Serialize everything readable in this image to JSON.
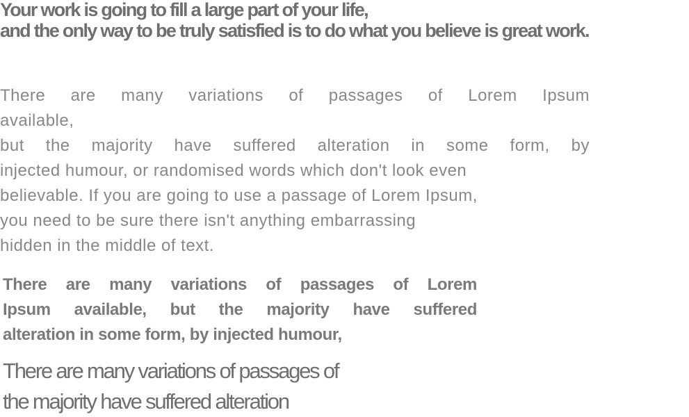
{
  "heading": {
    "line1": "Your work is going to fill a large part of your life,",
    "line2": "and the only way to be truly satisfied is to do what you believe is great work."
  },
  "paragraph_light": {
    "lines": [
      "There are many variations of passages of Lorem Ipsum",
      "available,",
      "but the majority have suffered alteration in some form, by",
      "injected humour, or randomised words which don't look even",
      "believable. If you are going to use a passage of Lorem Ipsum,",
      "you need to be sure there isn't anything embarrassing",
      "hidden in the middle of text."
    ]
  },
  "paragraph_bold": {
    "lines": [
      "There are many variations of passages of Lorem",
      "Ipsum available, but the majority have suffered",
      "alteration in some form, by injected humour,"
    ]
  },
  "paragraph_condensed": {
    "lines": [
      "There are many variations of passages of",
      "the majority have suffered alteration"
    ]
  }
}
